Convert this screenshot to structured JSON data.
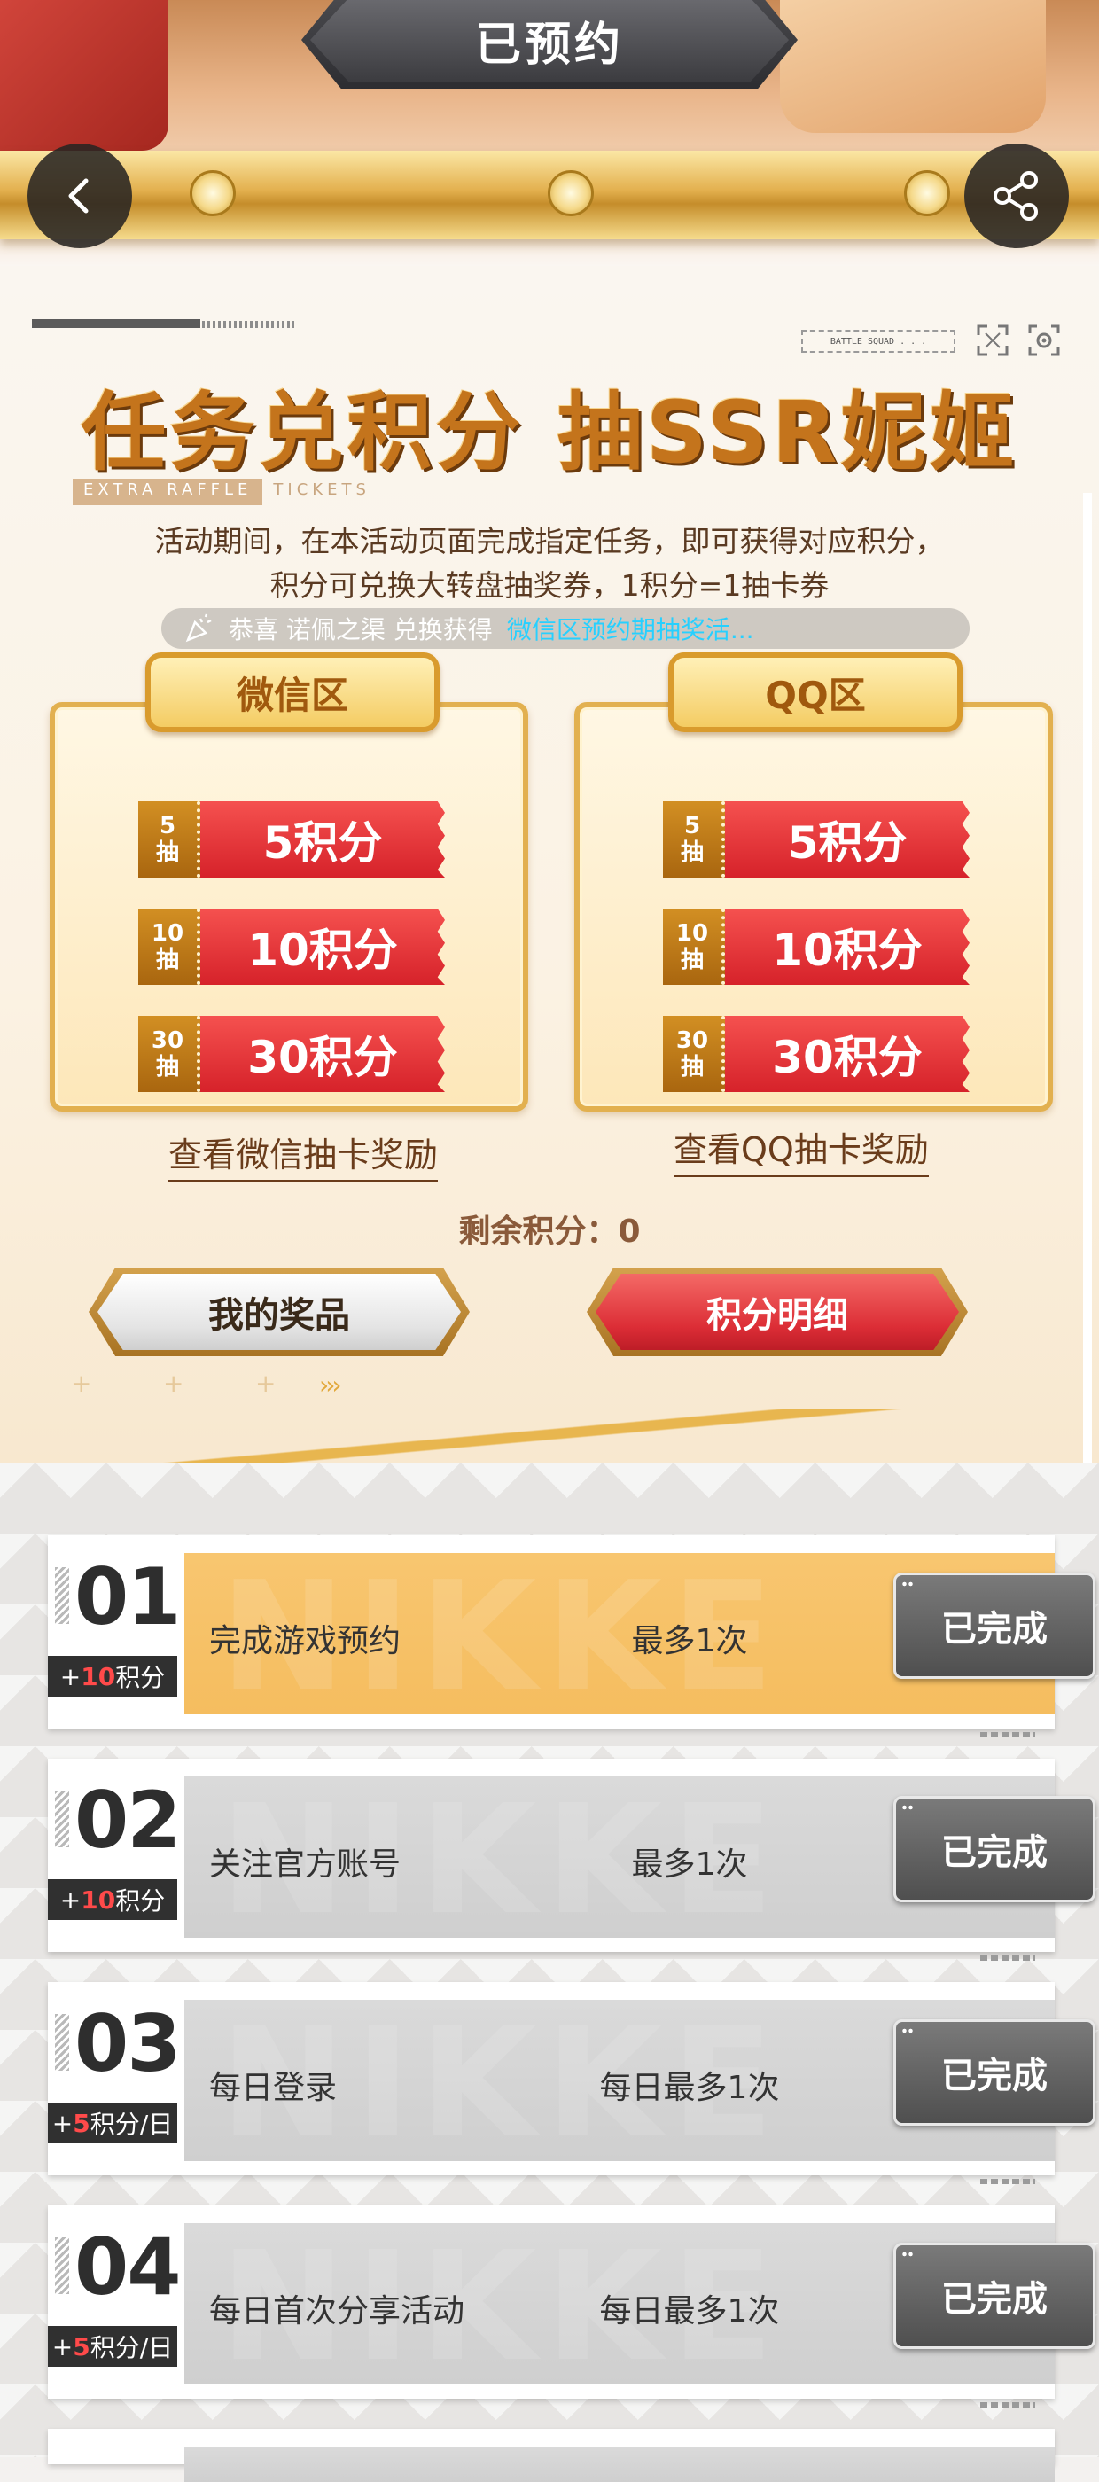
{
  "header": {
    "status_label": "已预约",
    "back_icon": "chevron-left-icon",
    "share_icon": "share-icon"
  },
  "event": {
    "squad_tag": "BATTLE SQUAD . . .",
    "title": "任务兑积分  抽SSR妮姬",
    "subtitle_tag_left": "EXTRA RAFFLE",
    "subtitle_tag_right": "TICKETS",
    "description_line1": "活动期间，在本活动页面完成指定任务，即可获得对应积分，",
    "description_line2": "积分可兑换大转盘抽奖券，1积分=1抽卡券",
    "marquee_prefix": "恭喜 诺佩之渠 兑换获得",
    "marquee_highlight": "微信区预约期抽奖活...",
    "zones": [
      {
        "label": "微信区",
        "link": "查看微信抽卡奖励",
        "rows": [
          {
            "count_num": "5",
            "count_unit": "抽",
            "points": "5积分"
          },
          {
            "count_num": "10",
            "count_unit": "抽",
            "points": "10积分"
          },
          {
            "count_num": "30",
            "count_unit": "抽",
            "points": "30积分"
          }
        ]
      },
      {
        "label": "QQ区",
        "link": "查看QQ抽卡奖励",
        "rows": [
          {
            "count_num": "5",
            "count_unit": "抽",
            "points": "5积分"
          },
          {
            "count_num": "10",
            "count_unit": "抽",
            "points": "10积分"
          },
          {
            "count_num": "30",
            "count_unit": "抽",
            "points": "30积分"
          }
        ]
      }
    ],
    "remaining_points": "剩余积分：0",
    "my_prizes_button": "我的奖品",
    "points_detail_button": "积分明细",
    "chevrons": "›››"
  },
  "tasks": [
    {
      "num": "01",
      "points_sign": "+",
      "points_value": "10",
      "points_unit": "积分",
      "name": "完成游戏预约",
      "limit": "最多1次",
      "button": "已完成"
    },
    {
      "num": "02",
      "points_sign": "+",
      "points_value": "10",
      "points_unit": "积分",
      "name": "关注官方账号",
      "limit": "最多1次",
      "button": "已完成"
    },
    {
      "num": "03",
      "points_sign": "+",
      "points_value": "5",
      "points_unit": "积分/日",
      "name": "每日登录",
      "limit": "每日最多1次",
      "button": "已完成"
    },
    {
      "num": "04",
      "points_sign": "+",
      "points_value": "5",
      "points_unit": "积分/日",
      "name": "每日首次分享活动",
      "limit": "每日最多1次",
      "button": "已完成"
    }
  ],
  "watermark": "NIKKE",
  "colors": {
    "accent_gold": "#e2b04f",
    "accent_red": "#d6222a",
    "active_task": "#f5bd5f",
    "done_button": "#5b5b5b",
    "marquee_highlight": "#27d0ff"
  }
}
